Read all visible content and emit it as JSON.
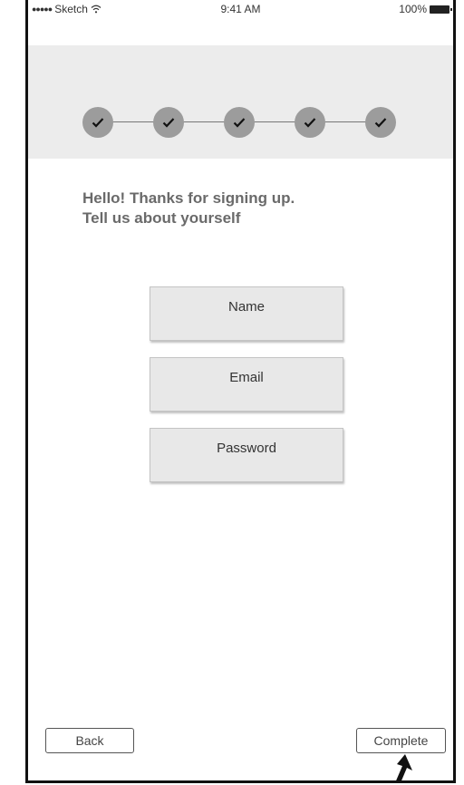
{
  "status_bar": {
    "signal": "●●●●●",
    "carrier": "Sketch",
    "time": "9:41 AM",
    "battery_percent": "100%"
  },
  "stepper": {
    "total_steps": 5,
    "completed_steps": 5
  },
  "greeting": {
    "line1": "Hello! Thanks for signing up.",
    "line2": "Tell us about yourself"
  },
  "form": {
    "name_label": "Name",
    "email_label": "Email",
    "password_label": "Password"
  },
  "footer": {
    "back_label": "Back",
    "complete_label": "Complete"
  }
}
